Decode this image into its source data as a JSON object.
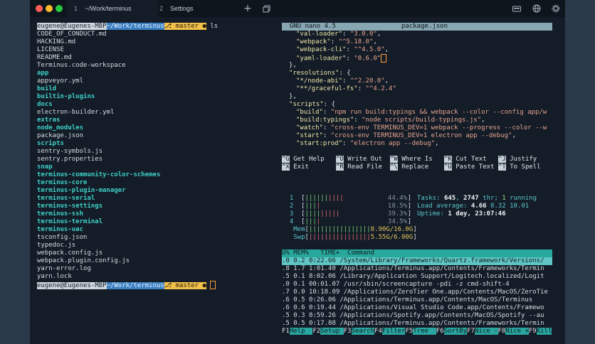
{
  "window": {
    "tabs": [
      {
        "index": "1",
        "label": "~/Work/terminus"
      },
      {
        "index": "2",
        "label": "Settings"
      }
    ],
    "toolbar_icons": [
      "plus-icon",
      "window-icon",
      "keyboard-icon",
      "globe-icon",
      "gear-icon"
    ],
    "colors": {
      "close": "#ff5f57",
      "minimize": "#febc2e",
      "maximize": "#28c840",
      "accent_teal": "#2aa6a0"
    }
  },
  "left": {
    "prompt": {
      "user": "eugene@Eugenes-MBP",
      "dir": "~/Work/terminus",
      "branch": "⎇ master ●",
      "command": "ls"
    },
    "listing": [
      {
        "name": "CODE_OF_CONDUCT.md",
        "dir": false
      },
      {
        "name": "HACKING.md",
        "dir": false
      },
      {
        "name": "LICENSE",
        "dir": false
      },
      {
        "name": "README.md",
        "dir": false
      },
      {
        "name": "Terminus.code-workspace",
        "dir": false
      },
      {
        "name": "app",
        "dir": true
      },
      {
        "name": "appveyor.yml",
        "dir": false
      },
      {
        "name": "build",
        "dir": true
      },
      {
        "name": "builtin-plugins",
        "dir": true
      },
      {
        "name": "docs",
        "dir": true
      },
      {
        "name": "electron-builder.yml",
        "dir": false
      },
      {
        "name": "extras",
        "dir": true
      },
      {
        "name": "node_modules",
        "dir": true
      },
      {
        "name": "package.json",
        "dir": false
      },
      {
        "name": "scripts",
        "dir": true
      },
      {
        "name": "sentry-symbols.js",
        "dir": false
      },
      {
        "name": "sentry.properties",
        "dir": false
      },
      {
        "name": "snap",
        "dir": true
      },
      {
        "name": "terminus-community-color-schemes",
        "dir": true
      },
      {
        "name": "terminus-core",
        "dir": true
      },
      {
        "name": "terminus-plugin-manager",
        "dir": true
      },
      {
        "name": "terminus-serial",
        "dir": true
      },
      {
        "name": "terminus-settings",
        "dir": true
      },
      {
        "name": "terminus-ssh",
        "dir": true
      },
      {
        "name": "terminus-terminal",
        "dir": true
      },
      {
        "name": "terminus-uac",
        "dir": true
      },
      {
        "name": "tsconfig.json",
        "dir": false
      },
      {
        "name": "typedoc.js",
        "dir": false
      },
      {
        "name": "webpack.config.js",
        "dir": false
      },
      {
        "name": "webpack.plugin.config.js",
        "dir": false
      },
      {
        "name": "yarn-error.log",
        "dir": false
      },
      {
        "name": "yarn.lock",
        "dir": false
      }
    ],
    "prompt2": {
      "user": "eugene@Eugenes-MBP",
      "dir": "~/Work/terminus",
      "branch": "⎇ master ●"
    }
  },
  "nano": {
    "header_app": "GNU nano 4.5",
    "header_file": "package.json",
    "lines": [
      [
        [
          "k",
          "\"val-loader\""
        ],
        [
          "p",
          ": "
        ],
        [
          "s",
          "\"3.0.0\""
        ],
        [
          "p",
          ","
        ]
      ],
      [
        [
          "k",
          "\"webpack\""
        ],
        [
          "p",
          ": "
        ],
        [
          "s",
          "\"^5.18.0\""
        ],
        [
          "p",
          ","
        ]
      ],
      [
        [
          "k",
          "\"webpack-cli\""
        ],
        [
          "p",
          ": "
        ],
        [
          "s",
          "\"^4.5.0\""
        ],
        [
          "p",
          ","
        ]
      ],
      [
        [
          "k",
          "\"yaml-loader\""
        ],
        [
          "p",
          ": "
        ],
        [
          "s",
          "\"0.6.0\""
        ]
      ],
      [
        [
          "p",
          "},"
        ]
      ],
      [
        [
          "k",
          "\"resolutions\""
        ],
        [
          "p",
          ": {"
        ]
      ],
      [
        [
          "k",
          "\"*/node-abi\""
        ],
        [
          "p",
          ": "
        ],
        [
          "s",
          "\"^2.20.0\""
        ],
        [
          "p",
          ","
        ]
      ],
      [
        [
          "k",
          "\"**/graceful-fs\""
        ],
        [
          "p",
          ": "
        ],
        [
          "s",
          "\"^4.2.4\""
        ]
      ],
      [
        [
          "p",
          "},"
        ]
      ],
      [
        [
          "k",
          "\"scripts\""
        ],
        [
          "p",
          ": {"
        ]
      ],
      [
        [
          "k",
          "\"build\""
        ],
        [
          "p",
          ": "
        ],
        [
          "s",
          "\"npm run build:typings && webpack --color --config app/w"
        ]
      ],
      [
        [
          "k",
          "\"build:typings\""
        ],
        [
          "p",
          ": "
        ],
        [
          "s",
          "\"node scripts/build-typings.js\""
        ],
        [
          "p",
          ","
        ]
      ],
      [
        [
          "k",
          "\"watch\""
        ],
        [
          "p",
          ": "
        ],
        [
          "s",
          "\"cross-env TERMINUS_DEV=1 webpack --progress --color --w"
        ]
      ],
      [
        [
          "k",
          "\"start\""
        ],
        [
          "p",
          ": "
        ],
        [
          "s",
          "\"cross-env TERMINUS_DEV=1 electron app --debug\""
        ],
        [
          "p",
          ","
        ]
      ],
      [
        [
          "k",
          "\"start:prod\""
        ],
        [
          "p",
          ": "
        ],
        [
          "s",
          "\"electron app --debug\""
        ],
        [
          "p",
          ","
        ]
      ]
    ],
    "indents": [
      2,
      2,
      2,
      2,
      1,
      1,
      2,
      2,
      1,
      1,
      2,
      2,
      2,
      2,
      2
    ],
    "shortcuts": [
      [
        {
          "key": "^G",
          "label": "Get Help"
        },
        {
          "key": "^O",
          "label": "Write Out"
        },
        {
          "key": "^W",
          "label": "Where Is"
        },
        {
          "key": "^K",
          "label": "Cut Text"
        },
        {
          "key": "^J",
          "label": "Justify"
        }
      ],
      [
        {
          "key": "^X",
          "label": "Exit"
        },
        {
          "key": "^R",
          "label": "Read File"
        },
        {
          "key": "^\\",
          "label": "Replace"
        },
        {
          "key": "^U",
          "label": "Paste Text"
        },
        {
          "key": "^T",
          "label": "To Spell"
        }
      ]
    ]
  },
  "htop": {
    "cpus": [
      {
        "id": "1",
        "bars": [
          [
            "g",
            "||||||"
          ],
          [
            "r",
            "||||"
          ]
        ],
        "pct": "44.4%"
      },
      {
        "id": "2",
        "bars": [
          [
            "g",
            "|||"
          ],
          [
            "r",
            "|"
          ]
        ],
        "pct": "18.5%"
      },
      {
        "id": "3",
        "bars": [
          [
            "g",
            "||||"
          ],
          [
            "r",
            "|||||"
          ]
        ],
        "pct": "39.3%"
      },
      {
        "id": "4",
        "bars": [
          [
            "g",
            "|||"
          ],
          [
            "r",
            "|"
          ]
        ],
        "pct": "34.5%"
      }
    ],
    "mem": {
      "label": "Mem",
      "bars": "||||||||||||||||",
      "value": "8.90G/16.0G"
    },
    "swp": {
      "label": "Swp",
      "bars": "||||||||||||||||",
      "value": "5.55G/6.00G"
    },
    "tasks": {
      "label": "Tasks: ",
      "count": "645",
      "sep": ", ",
      "thr": "2747",
      "thr_label": " thr; ",
      "running": "1",
      "running_label": " running"
    },
    "load": {
      "label": "Load average: ",
      "v1": "4.66",
      "v2": "8.32",
      "v3": "10.01"
    },
    "uptime": {
      "label": "Uptime: ",
      "value": "1 day, 23:07:46"
    },
    "header": {
      "cpu": "U%",
      "mem": "MEM%",
      "time": "TIME+",
      "command": "Command"
    },
    "rows": [
      {
        "cpu": ".0",
        "mem": "0.2",
        "time": "0:22.66",
        "command": "/System/Library/Frameworks/Quartz.framework/Versions/"
      },
      {
        "cpu": ".8",
        "mem": "1.7",
        "time": "1:01.40",
        "command": "/Applications/Terminus.app/Contents/Frameworks/Termin"
      },
      {
        "cpu": ".5",
        "mem": "0.1",
        "time": "8:02.06",
        "command": "/Library/Application Support/Logitech.localized/Logit"
      },
      {
        "cpu": ".0",
        "mem": "0.1",
        "time": "00:01.07",
        "command": "/usr/sbin/screencapture -pdi -z cmd-shift-4"
      },
      {
        "cpu": ".7",
        "mem": "0.0",
        "time": "10:18.09",
        "command": "/Applications/ZeroTier One.app/Contents/MacOS/ZeroTie"
      },
      {
        "cpu": ".6",
        "mem": "0.5",
        "time": "0:26.06",
        "command": "/Applications/Terminus.app/Contents/MacOS/Terminus"
      },
      {
        "cpu": ".6",
        "mem": "0.6",
        "time": "0:19.44",
        "command": "/Applications/Visual Studio Code.app/Contents/Framewo"
      },
      {
        "cpu": ".5",
        "mem": "0.3",
        "time": "8:59.26",
        "command": "/Applications/Spotify.app/Contents/MacOS/Spotify --au"
      },
      {
        "cpu": ".5",
        "mem": "0.5",
        "time": "0:17.08",
        "command": "/Applications/Terminus.app/Contents/Frameworks/Termin"
      }
    ],
    "fkeys": [
      {
        "key": "F1",
        "label": "Help  "
      },
      {
        "key": "F2",
        "label": "Setup "
      },
      {
        "key": "F3",
        "label": "Search"
      },
      {
        "key": "F4",
        "label": "Filter"
      },
      {
        "key": "F5",
        "label": "Tree  "
      },
      {
        "key": "F6",
        "label": "SortBy"
      },
      {
        "key": "F7",
        "label": "Nice -"
      },
      {
        "key": "F8",
        "label": "Nice +"
      },
      {
        "key": "F9",
        "label": "Kill"
      }
    ]
  }
}
